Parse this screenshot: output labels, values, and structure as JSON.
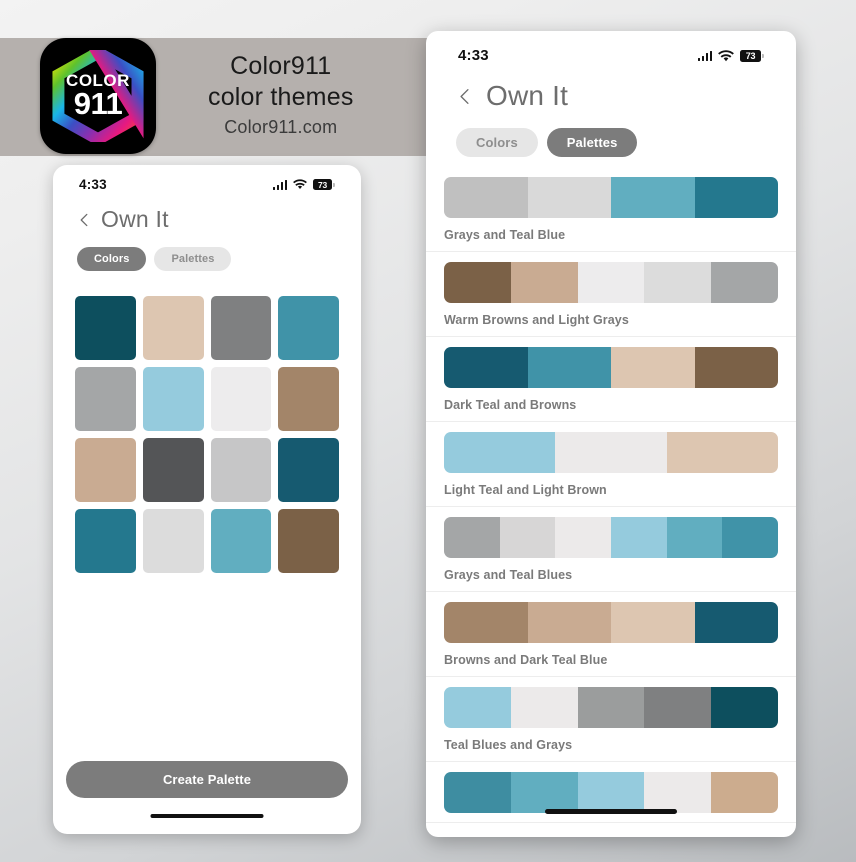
{
  "banner": {
    "icon_line1": "COLOR",
    "icon_line2": "911",
    "line1": "Color911",
    "line2": "color themes",
    "line3": "Color911.com",
    "bg": "#b5b0ad"
  },
  "phone_left": {
    "status": {
      "time": "4:33",
      "battery": "73"
    },
    "nav": {
      "back_icon": "chevron-left-icon",
      "title": "Own It"
    },
    "tabs": [
      {
        "label": "Colors",
        "selected": true
      },
      {
        "label": "Palettes",
        "selected": false
      }
    ],
    "colors": [
      "#0d4f5e",
      "#ddc6b1",
      "#7f8081",
      "#4093a8",
      "#a4a6a7",
      "#95cbdd",
      "#edeced",
      "#a38569",
      "#c9ab92",
      "#545557",
      "#c6c6c7",
      "#165a70",
      "#24788e",
      "#dcdcdc",
      "#61aec0",
      "#7b6147"
    ],
    "cta_label": "Create Palette"
  },
  "phone_right": {
    "status": {
      "time": "4:33",
      "battery": "73"
    },
    "nav": {
      "back_icon": "chevron-left-icon",
      "title": "Own It"
    },
    "tabs": [
      {
        "label": "Colors",
        "selected": false
      },
      {
        "label": "Palettes",
        "selected": true
      }
    ],
    "palettes": [
      {
        "label": "Grays and Teal Blue",
        "colors": [
          "#c0c0c0",
          "#d9d9d9",
          "#61aec0",
          "#24788e"
        ]
      },
      {
        "label": "Warm Browns and Light Grays",
        "colors": [
          "#7b6147",
          "#c9ab92",
          "#edeced",
          "#dcdcdc",
          "#a4a6a7"
        ]
      },
      {
        "label": "Dark Teal and Browns",
        "colors": [
          "#165a70",
          "#4093a8",
          "#ddc6b1",
          "#7b6147"
        ]
      },
      {
        "label": "Light Teal and Light Brown",
        "colors": [
          "#95cbdd",
          "#eceaea",
          "#ddc6b1"
        ]
      },
      {
        "label": "Grays and Teal Blues",
        "colors": [
          "#a4a6a7",
          "#d7d6d6",
          "#eceaea",
          "#95cbdd",
          "#61aec0",
          "#4093a8"
        ]
      },
      {
        "label": "Browns and Dark Teal Blue",
        "colors": [
          "#a38569",
          "#c9ab92",
          "#ddc6b1",
          "#165a70"
        ]
      },
      {
        "label": "Teal Blues and Grays",
        "colors": [
          "#95cbdd",
          "#eceaea",
          "#9b9d9d",
          "#7f8081",
          "#0d4f5e"
        ]
      },
      {
        "label": "",
        "colors": [
          "#3e8da1",
          "#61aec0",
          "#95cbdd",
          "#eceaea",
          "#ccac8e"
        ]
      }
    ]
  }
}
